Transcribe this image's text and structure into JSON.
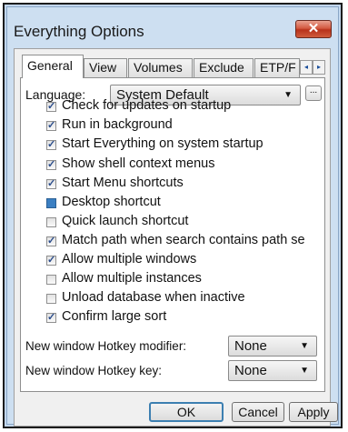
{
  "window": {
    "title": "Everything Options",
    "close_label": "✕"
  },
  "tabs": [
    {
      "label": "General",
      "active": true
    },
    {
      "label": "View"
    },
    {
      "label": "Volumes"
    },
    {
      "label": "Exclude"
    },
    {
      "label": "ETP/F"
    }
  ],
  "tab_scroll": {
    "left": "◂",
    "right": "▸"
  },
  "language": {
    "label": "Language:",
    "value": "System Default",
    "browse_label": "..."
  },
  "options": [
    {
      "label": "Check for updates on startup",
      "state": "checked"
    },
    {
      "label": "Run in background",
      "state": "checked"
    },
    {
      "label": "Start Everything on system startup",
      "state": "checked"
    },
    {
      "label": "Show shell context menus",
      "state": "checked"
    },
    {
      "label": "Start Menu shortcuts",
      "state": "checked"
    },
    {
      "label": "Desktop shortcut",
      "state": "indeterminate"
    },
    {
      "label": "Quick launch shortcut",
      "state": "unchecked"
    },
    {
      "label": "Match path when search contains path se",
      "state": "checked"
    },
    {
      "label": "Allow multiple windows",
      "state": "checked"
    },
    {
      "label": "Allow multiple instances",
      "state": "unchecked"
    },
    {
      "label": "Unload database when inactive",
      "state": "unchecked"
    },
    {
      "label": "Confirm large sort",
      "state": "checked"
    }
  ],
  "hotkeys": {
    "modifier": {
      "label": "New window Hotkey modifier:",
      "value": "None"
    },
    "key": {
      "label": "New window Hotkey key:",
      "value": "None"
    }
  },
  "buttons": {
    "ok": "OK",
    "cancel": "Cancel",
    "apply": "Apply"
  },
  "colors": {
    "frame": "#c2d6ec",
    "close_button": "#c8452c",
    "check": "#2b4d8c",
    "indeterminate": "#3b7fc2"
  }
}
